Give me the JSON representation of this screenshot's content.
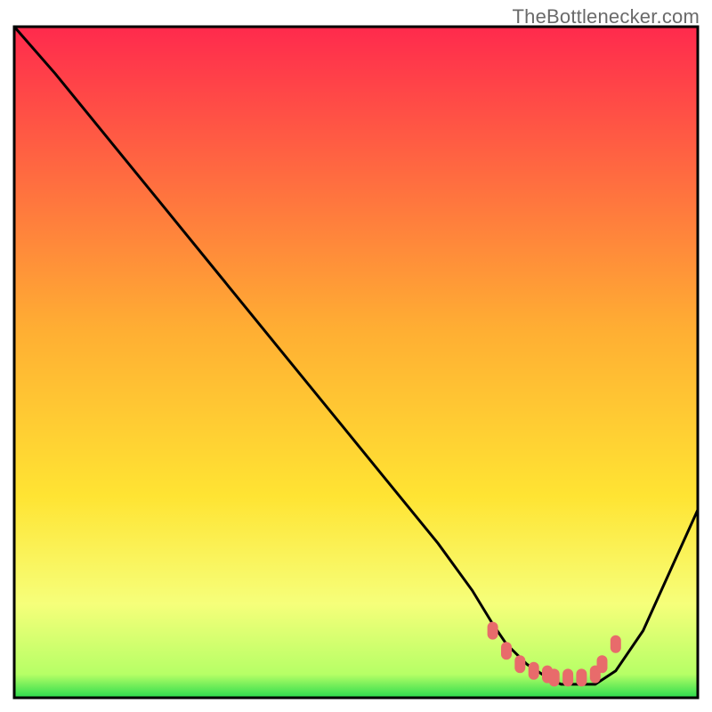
{
  "watermark": {
    "text": "TheBottlenecker.com"
  },
  "colors": {
    "frame": "#000000",
    "curve_stroke": "#000000",
    "dot_fill": "#e86b6b",
    "grad_top": "#ff2a4d",
    "grad_mid": "#ffd633",
    "grad_low": "#f6ff7a",
    "grad_bottom": "#2bdb4e"
  },
  "chart_data": {
    "type": "line",
    "title": "",
    "xlabel": "",
    "ylabel": "",
    "xlim": [
      0,
      100
    ],
    "ylim": [
      0,
      100
    ],
    "grid": false,
    "legend": false,
    "series": [
      {
        "name": "bottleneck-curve",
        "x": [
          0,
          6,
          14,
          22,
          30,
          38,
          46,
          54,
          62,
          67,
          70,
          72,
          75,
          78,
          80,
          82,
          85,
          88,
          92,
          96,
          100
        ],
        "y": [
          100,
          93,
          83,
          73,
          63,
          53,
          43,
          33,
          23,
          16,
          11,
          8,
          5,
          3,
          2,
          2,
          2,
          4,
          10,
          19,
          28
        ]
      }
    ],
    "markers": {
      "name": "bottom-dots",
      "x": [
        70,
        72,
        74,
        76,
        78,
        79,
        81,
        83,
        85,
        86,
        88
      ],
      "y": [
        10,
        7,
        5,
        4,
        3.5,
        3,
        3,
        3,
        3.5,
        5,
        8
      ]
    },
    "background_gradient_stops": [
      {
        "offset": 0.0,
        "color": "#ff2a4d"
      },
      {
        "offset": 0.45,
        "color": "#ffae33"
      },
      {
        "offset": 0.7,
        "color": "#ffe433"
      },
      {
        "offset": 0.86,
        "color": "#f6ff7a"
      },
      {
        "offset": 0.965,
        "color": "#b6ff66"
      },
      {
        "offset": 1.0,
        "color": "#2bdb4e"
      }
    ]
  }
}
